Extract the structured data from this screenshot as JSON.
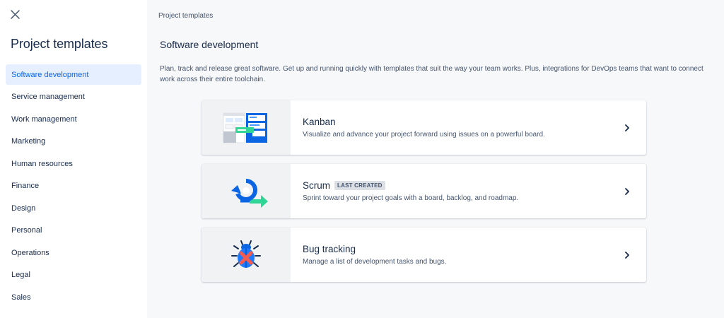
{
  "sidebar": {
    "title": "Project templates",
    "items": [
      {
        "label": "Software development",
        "active": true
      },
      {
        "label": "Service management"
      },
      {
        "label": "Work management"
      },
      {
        "label": "Marketing"
      },
      {
        "label": "Human resources"
      },
      {
        "label": "Finance"
      },
      {
        "label": "Design"
      },
      {
        "label": "Personal"
      },
      {
        "label": "Operations"
      },
      {
        "label": "Legal"
      },
      {
        "label": "Sales"
      }
    ]
  },
  "main": {
    "breadcrumb": "Project templates",
    "section_title": "Software development",
    "section_description": "Plan, track and release great software. Get up and running quickly with templates that suit the way your team works. Plus, integrations for DevOps teams that want to connect work across their entire toolchain.",
    "templates": [
      {
        "title": "Kanban",
        "description": "Visualize and advance your project forward using issues on a powerful board.",
        "icon": "kanban-board-icon"
      },
      {
        "title": "Scrum",
        "badge": "LAST CREATED",
        "description": "Sprint toward your project goals with a board, backlog, and roadmap.",
        "icon": "scrum-cycle-icon"
      },
      {
        "title": "Bug tracking",
        "description": "Manage a list of development tasks and bugs.",
        "icon": "bug-icon"
      }
    ]
  },
  "colors": {
    "accent": "#0c66e4",
    "active_bg": "#e6efff",
    "text": "#172b4d",
    "subtle_text": "#44546f",
    "page_bg": "#f7f8f9"
  }
}
